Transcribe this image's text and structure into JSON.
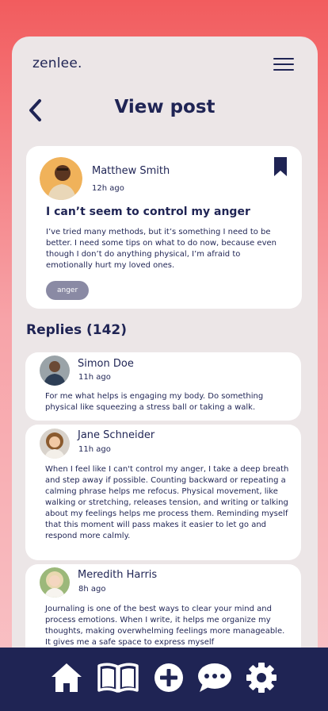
{
  "app": {
    "logo": "zenlee."
  },
  "header": {
    "title": "View post"
  },
  "post": {
    "author": "Matthew Smith",
    "time": "12h ago",
    "title": "I can’t seem to control my anger",
    "body": "I’ve tried many methods, but it’s something I need to be better. I need some tips on what to do now, because even though I don’t do anything physical, I’m afraid to emotionally hurt my loved ones.",
    "tag": "anger",
    "bookmarked": true
  },
  "replies": {
    "heading": "Replies (142)",
    "items": [
      {
        "name": "Simon Doe",
        "time": "11h ago",
        "body": "For me what helps is engaging my body. Do something physical like squeezing a stress ball or taking a walk."
      },
      {
        "name": "Jane Schneider",
        "time": "11h ago",
        "body": "When I feel like I can't control my anger, I take a deep breath and step away if possible. Counting backward or repeating a calming phrase helps me refocus. Physical movement, like walking or stretching, releases tension, and writing or talking about my feelings helps me process them. Reminding myself that this moment will pass makes it easier to let go and respond more calmly."
      },
      {
        "name": "Meredith Harris",
        "time": "8h ago",
        "body": "Journaling is one of the best ways to clear your mind and process emotions. When I write, it helps me organize my thoughts, making overwhelming feelings more manageable. It gives me a safe space to express myself"
      }
    ]
  },
  "nav": {
    "icons": [
      "home-icon",
      "book-icon",
      "add-icon",
      "chat-icon",
      "settings-icon"
    ]
  },
  "colors": {
    "navy": "#1f2454",
    "panel": "#ece6e7",
    "tag": "#8a8aa4",
    "gradient_top": "#f25c5e"
  }
}
